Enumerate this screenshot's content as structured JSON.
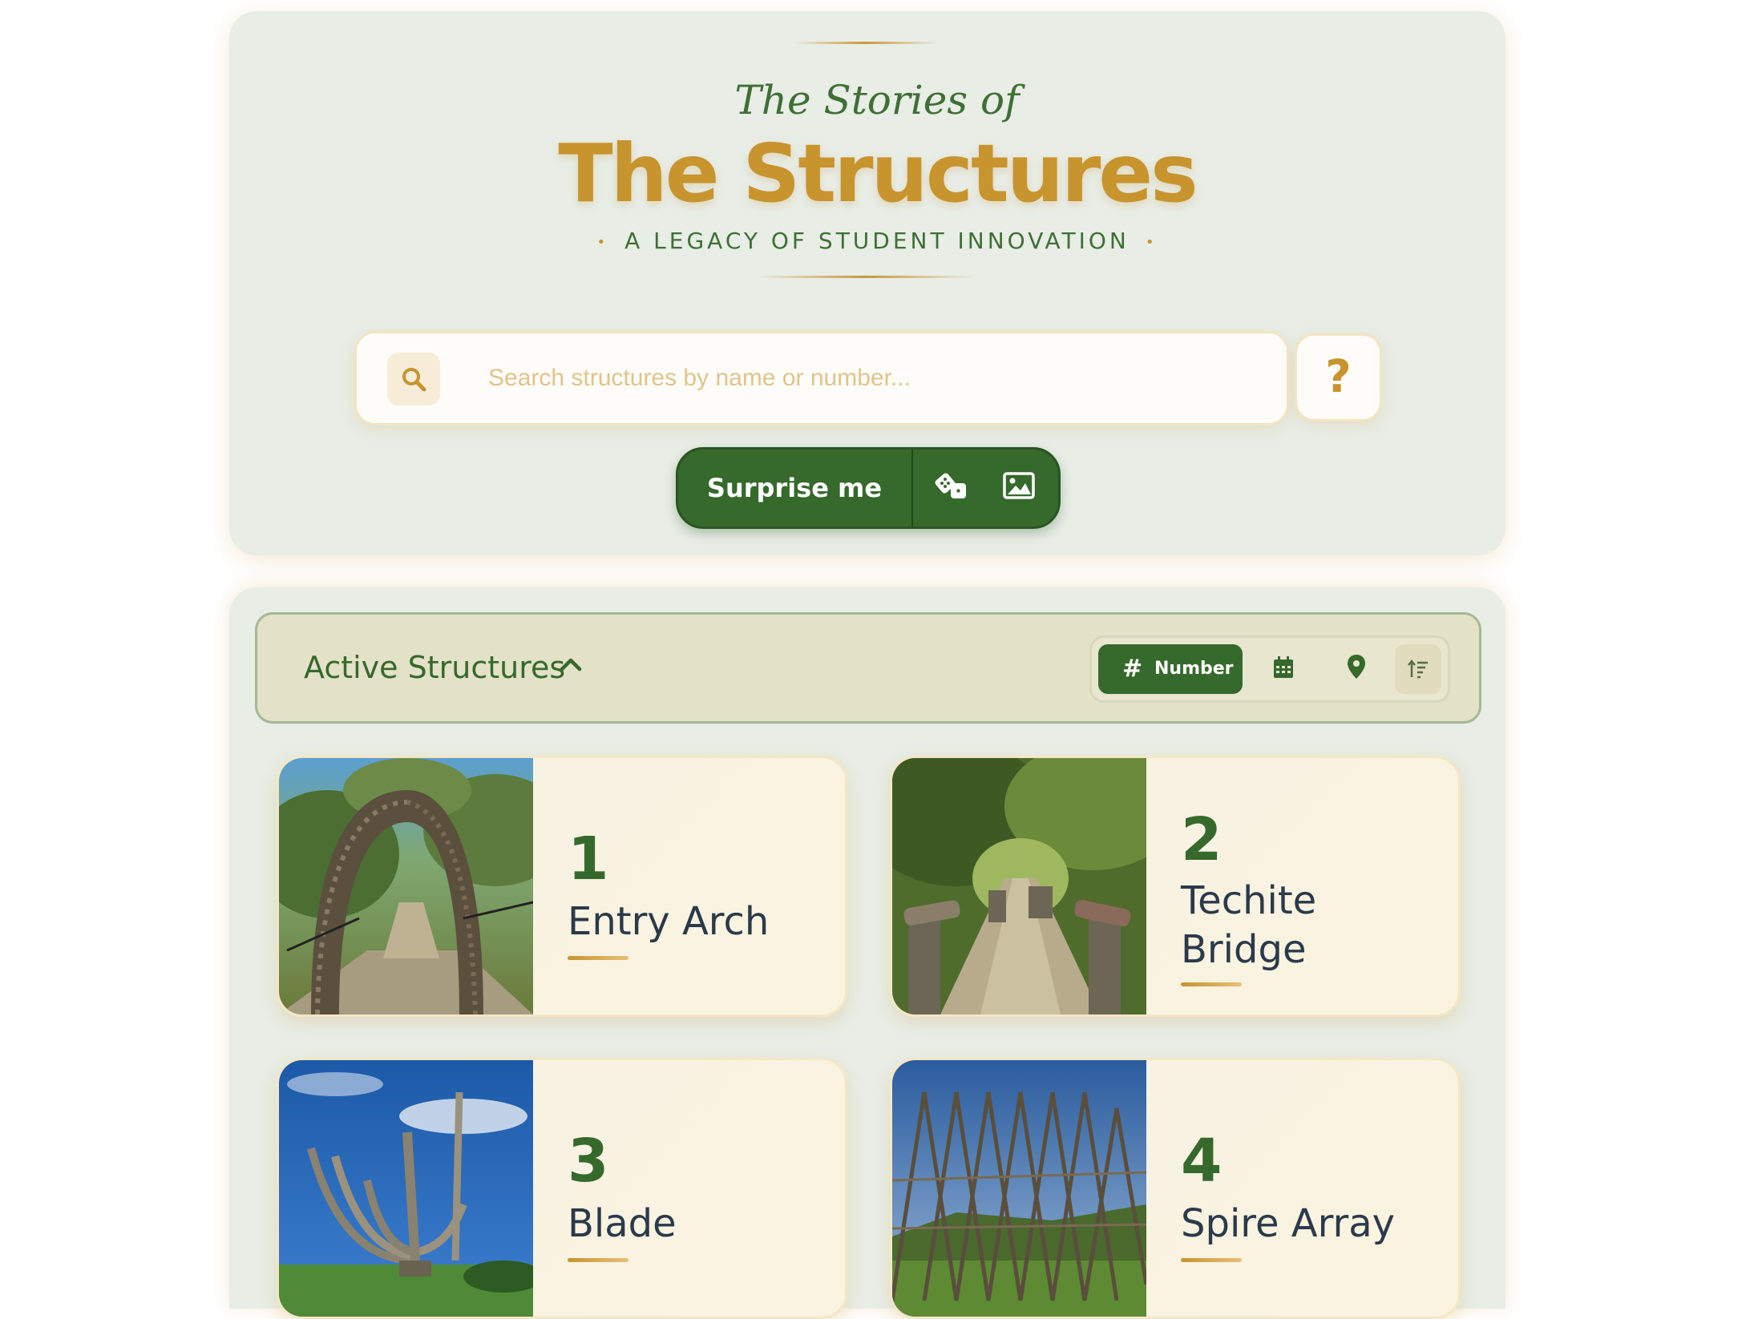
{
  "hero": {
    "pre_title": "The Stories of",
    "title": "The Structures",
    "tagline": "A LEGACY OF STUDENT INNOVATION"
  },
  "search": {
    "placeholder": "Search structures by name or number...",
    "help_label": "?"
  },
  "actions": {
    "surprise_label": "Surprise me",
    "icons": [
      "dice-icon",
      "image-icon"
    ]
  },
  "section": {
    "title": "Active Structures",
    "sort_options": [
      {
        "label": "Number",
        "icon": "hash-icon",
        "active": true
      },
      {
        "label": "",
        "icon": "calendar-icon",
        "active": false
      },
      {
        "label": "",
        "icon": "location-pin-icon",
        "active": false
      },
      {
        "label": "",
        "icon": "sort-direction-icon",
        "active": false
      }
    ]
  },
  "colors": {
    "accent_green": "#36692c",
    "gold": "#c7942e",
    "panel": "#e8ede6",
    "card": "#faf3df"
  },
  "cards": [
    {
      "number": "1",
      "name": "Entry Arch"
    },
    {
      "number": "2",
      "name": "Techite Bridge"
    },
    {
      "number": "3",
      "name": "Blade"
    },
    {
      "number": "4",
      "name": "Spire Array"
    }
  ]
}
